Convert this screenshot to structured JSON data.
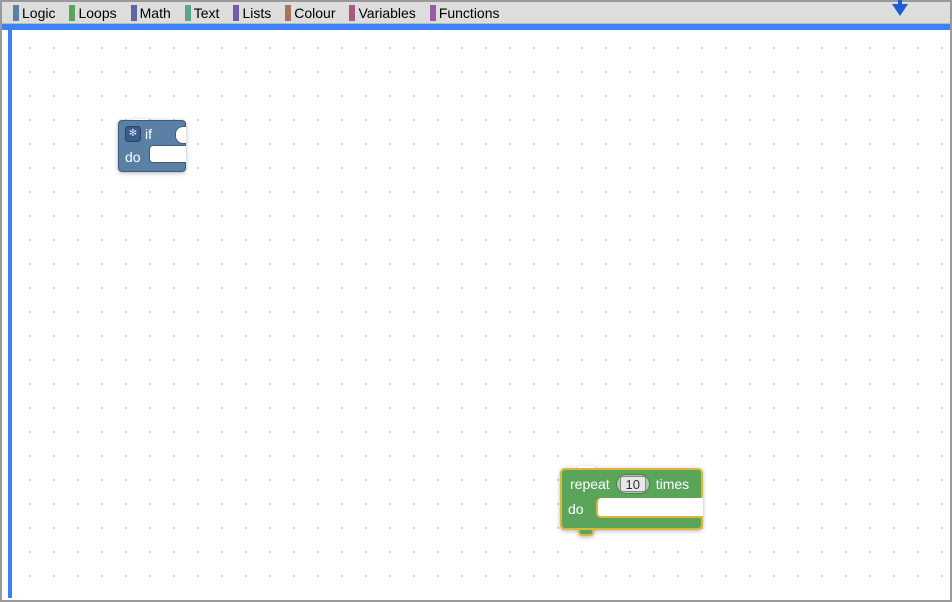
{
  "toolbox": {
    "categories": [
      {
        "label": "Logic",
        "color": "#5b80a5"
      },
      {
        "label": "Loops",
        "color": "#5ba55b"
      },
      {
        "label": "Math",
        "color": "#5b67a5"
      },
      {
        "label": "Text",
        "color": "#5ba58c"
      },
      {
        "label": "Lists",
        "color": "#745ba5"
      },
      {
        "label": "Colour",
        "color": "#a5745b"
      },
      {
        "label": "Variables",
        "color": "#a55b80"
      },
      {
        "label": "Functions",
        "color": "#995ba5"
      }
    ]
  },
  "blocks": {
    "if_block": {
      "if_label": "if",
      "do_label": "do",
      "gear_symbol": "✻"
    },
    "repeat_block": {
      "repeat_label": "repeat",
      "times_label": "times",
      "do_label": "do",
      "count_value": "10"
    }
  }
}
